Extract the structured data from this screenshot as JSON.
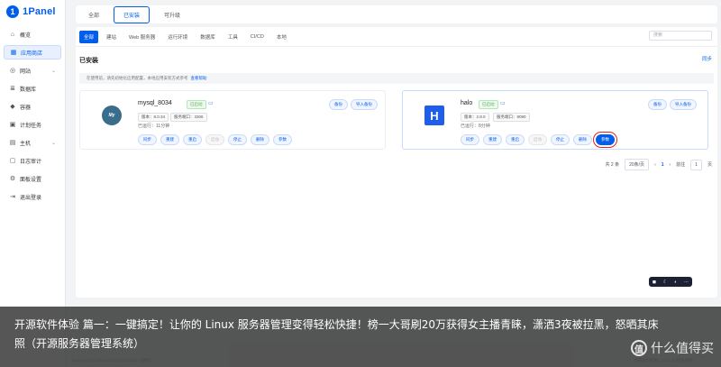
{
  "brand": {
    "logo_letter": "1",
    "name": "1Panel"
  },
  "sidebar": {
    "items": [
      {
        "label": "概览",
        "icon": "home-icon"
      },
      {
        "label": "应用商店",
        "icon": "grid-icon",
        "active": true
      },
      {
        "label": "网站",
        "icon": "globe-icon",
        "caret": "⌄"
      },
      {
        "label": "数据库",
        "icon": "database-icon"
      },
      {
        "label": "容器",
        "icon": "container-icon"
      },
      {
        "label": "计划任务",
        "icon": "calendar-icon"
      },
      {
        "label": "主机",
        "icon": "host-icon",
        "caret": "⌄"
      },
      {
        "label": "日志审计",
        "icon": "log-icon"
      },
      {
        "label": "面板设置",
        "icon": "settings-icon"
      },
      {
        "label": "退出登录",
        "icon": "logout-icon"
      }
    ]
  },
  "top_tabs": [
    {
      "label": "全部"
    },
    {
      "label": "已安装",
      "active": true
    },
    {
      "label": "可升级"
    }
  ],
  "categories": [
    {
      "label": "全部",
      "active": true
    },
    {
      "label": "建站"
    },
    {
      "label": "Web 服务器"
    },
    {
      "label": "运行环境"
    },
    {
      "label": "数据库"
    },
    {
      "label": "工具"
    },
    {
      "label": "CI/CD"
    },
    {
      "label": "本地"
    }
  ],
  "search": {
    "placeholder": "搜索"
  },
  "section": {
    "title": "已安装",
    "sync": "同步"
  },
  "notice": {
    "text": "在使用前，请先初始化应用配置，本地应用安装方式参考",
    "link": "查看帮助"
  },
  "apps": [
    {
      "name": "mysql_8034",
      "logo_text": "My",
      "status": "已启动",
      "tag_version": "版本：8.0.34",
      "tag_port": "服务端口：3306",
      "runtime": "已运行：11分钟",
      "btn_backup": "备份",
      "btn_import": "导入备份",
      "actions": [
        "同步",
        "重建",
        "重启",
        "启动",
        "停止",
        "删除",
        "参数"
      ]
    },
    {
      "name": "halo",
      "logo_text": "H",
      "status": "已启动",
      "tag_version": "版本：2.8.0",
      "tag_port": "服务端口：8090",
      "runtime": "已运行：8分钟",
      "btn_backup": "备份",
      "btn_import": "导入备份",
      "actions": [
        "同步",
        "重建",
        "重启",
        "启动",
        "停止",
        "删除",
        "参数"
      ]
    }
  ],
  "pager": {
    "total": "共 2 条",
    "size": "20条/页",
    "prev": "‹",
    "current": "1",
    "next": "›",
    "goto": "前往",
    "goto_value": "1",
    "page_unit": "页"
  },
  "float_toolbar": [
    "◼",
    "☾",
    "◐",
    "⋯"
  ],
  "footer": {
    "copyright": "Copyright © 2014-2023 FIT2CLOUD 飞致云",
    "version": "当前运行版本：V1.4.3",
    "update": "(检查更新)"
  },
  "caption": "开源软件体验 篇一：一键搞定！让你的 Linux 服务器管理变得轻松快捷！榜一大哥刷20万获得女主播青睐，潇洒3夜被拉黑，怒晒其床照（开源服务器管理系统）",
  "watermark": {
    "badge": "值",
    "text": "什么值得买"
  },
  "colors": {
    "accent": "#005eeb",
    "highlight": "#e02020",
    "running": "#4caf50"
  }
}
